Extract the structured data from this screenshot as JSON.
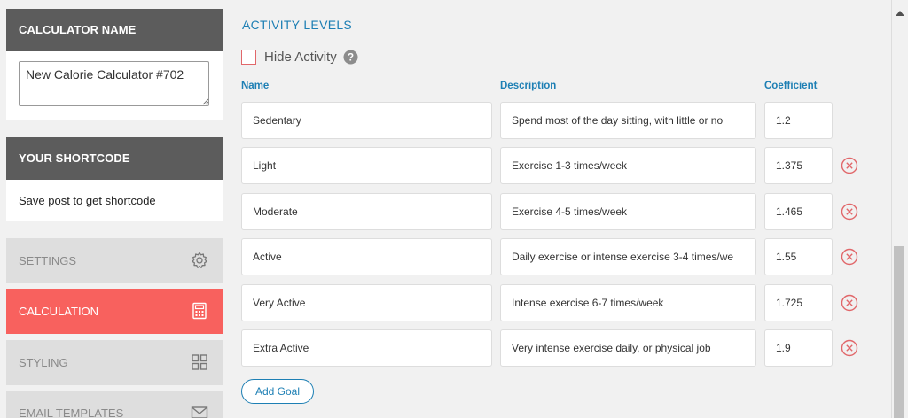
{
  "sidebar": {
    "calculator_name": {
      "heading": "CALCULATOR NAME",
      "value": "New Calorie Calculator #702"
    },
    "shortcode": {
      "heading": "YOUR SHORTCODE",
      "text": "Save post to get shortcode"
    },
    "nav": [
      {
        "label": "SETTINGS",
        "icon": "gear-icon",
        "active": false
      },
      {
        "label": "CALCULATION",
        "icon": "calculator-icon",
        "active": true
      },
      {
        "label": "STYLING",
        "icon": "grid-icon",
        "active": false
      },
      {
        "label": "EMAIL TEMPLATES",
        "icon": "envelope-icon",
        "active": false
      }
    ]
  },
  "main": {
    "section_title": "ACTIVITY LEVELS",
    "hide_activity": {
      "label": "Hide Activity",
      "checked": false
    },
    "columns": {
      "name": "Name",
      "description": "Description",
      "coefficient": "Coefficient"
    },
    "rows": [
      {
        "name": "Sedentary",
        "description": "Spend most of the day sitting, with little or no",
        "coefficient": "1.2",
        "removable": false
      },
      {
        "name": "Light",
        "description": "Exercise 1-3 times/week",
        "coefficient": "1.375",
        "removable": true
      },
      {
        "name": "Moderate",
        "description": "Exercise 4-5 times/week",
        "coefficient": "1.465",
        "removable": true
      },
      {
        "name": "Active",
        "description": "Daily exercise or intense exercise 3-4 times/we",
        "coefficient": "1.55",
        "removable": true
      },
      {
        "name": "Very Active",
        "description": "Intense exercise 6-7 times/week",
        "coefficient": "1.725",
        "removable": true
      },
      {
        "name": "Extra Active",
        "description": "Very intense exercise daily, or physical job",
        "coefficient": "1.9",
        "removable": true
      }
    ],
    "add_goal_label": "Add Goal"
  },
  "colors": {
    "accent_blue": "#1d7fb4",
    "active_nav": "#f8615e",
    "delete_red": "#e1676a",
    "panel_header": "#5c5c5c"
  }
}
